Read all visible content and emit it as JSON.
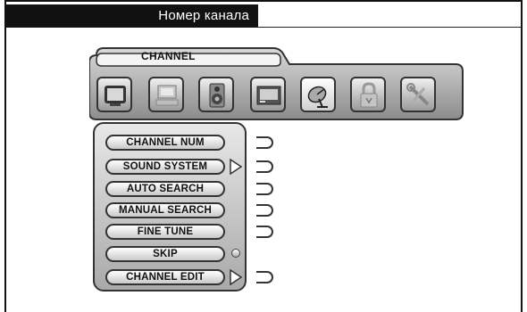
{
  "header": {
    "title": "Номер канала"
  },
  "tabbar": {
    "active_label": "CHANNEL",
    "icons": [
      "tv-icon",
      "computer-icon",
      "speaker-icon",
      "monitor-icon",
      "satellite-dish-icon",
      "padlock-icon",
      "tools-icon"
    ],
    "selected_index": 4
  },
  "menu": {
    "items": [
      {
        "label": "CHANNEL NUM",
        "has_arrow": false
      },
      {
        "label": "SOUND SYSTEM",
        "has_arrow": true
      },
      {
        "label": "AUTO SEARCH",
        "has_arrow": false
      },
      {
        "label": "MANUAL SEARCH",
        "has_arrow": false
      },
      {
        "label": "FINE TUNE",
        "has_arrow": false
      },
      {
        "label": "SKIP",
        "has_arrow": false
      },
      {
        "label": "CHANNEL EDIT",
        "has_arrow": true
      }
    ]
  }
}
